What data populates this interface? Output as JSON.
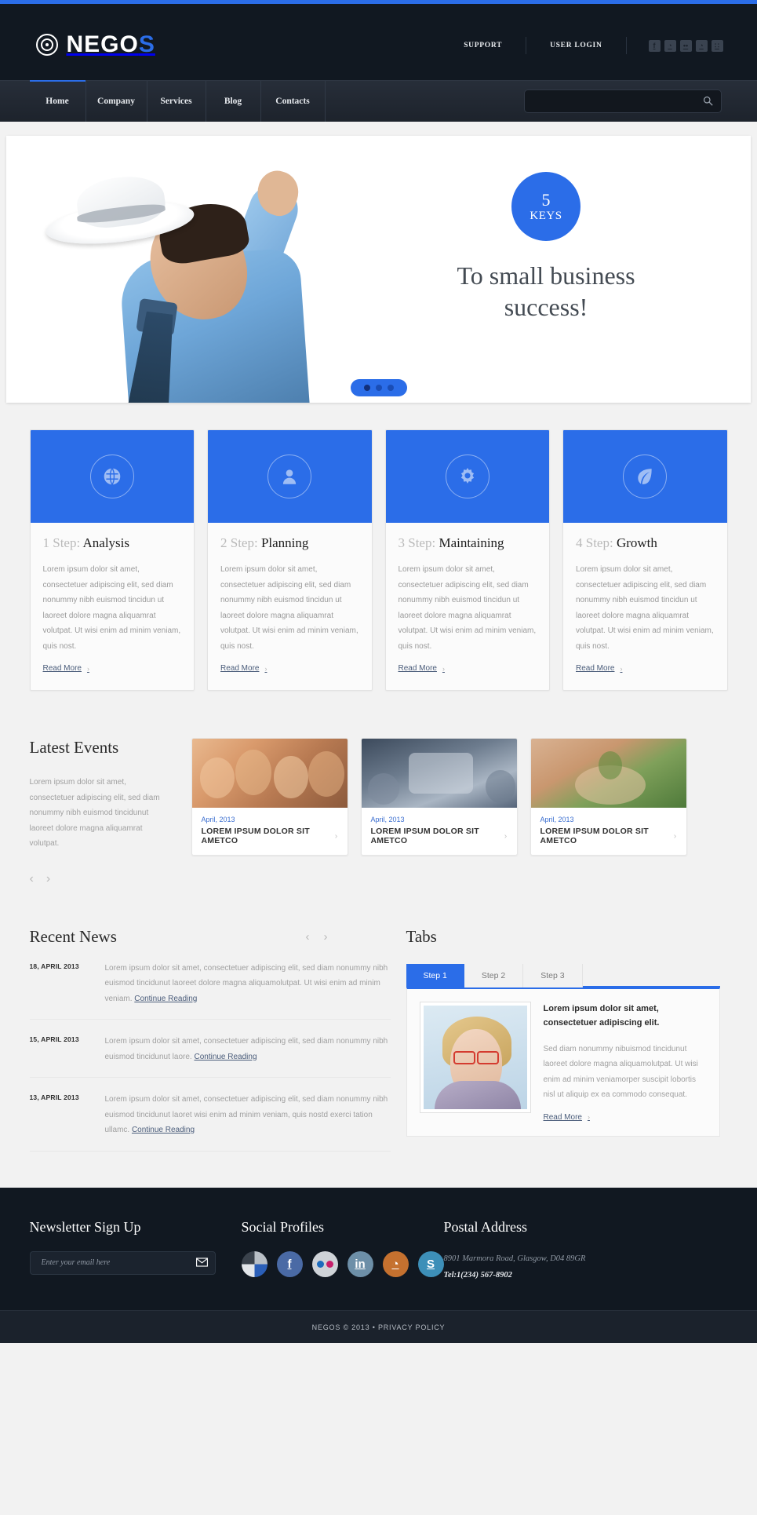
{
  "brand": {
    "name_main": "NEGO",
    "name_accent": "S"
  },
  "header": {
    "links": [
      {
        "label": "SUPPORT"
      },
      {
        "label": "USER LOGIN"
      }
    ],
    "socials": [
      {
        "name": "facebook-icon",
        "glyph": "f"
      },
      {
        "name": "rss-icon",
        "glyph": "◔"
      },
      {
        "name": "flickr-icon",
        "glyph": "••"
      },
      {
        "name": "rss-feed-icon",
        "glyph": "◔"
      },
      {
        "name": "dribbble-icon",
        "glyph": "∷"
      }
    ]
  },
  "nav": {
    "items": [
      {
        "label": "Home",
        "active": true
      },
      {
        "label": "Company",
        "active": false
      },
      {
        "label": "Services",
        "active": false
      },
      {
        "label": "Blog",
        "active": false
      },
      {
        "label": "Contacts",
        "active": false
      }
    ],
    "search_placeholder": ""
  },
  "slider": {
    "badge_number": "5",
    "badge_word": "KEYS",
    "title_line1": "To small business",
    "title_line2": "success!",
    "dots": 3,
    "active_dot": 1
  },
  "steps": [
    {
      "number": "1 Step:",
      "title": "Analysis",
      "icon": "globe-icon",
      "text": "Lorem ipsum dolor sit amet, consectetuer adipiscing elit, sed diam nonummy nibh euismod tincidun ut laoreet dolore magna aliquamrat volutpat. Ut wisi enim ad minim veniam, quis nost.",
      "link": "Read More"
    },
    {
      "number": "2 Step:",
      "title": "Planning",
      "icon": "user-icon",
      "text": "Lorem ipsum dolor sit amet, consectetuer adipiscing elit, sed diam nonummy nibh euismod tincidun ut laoreet dolore magna aliquamrat volutpat. Ut wisi enim ad minim veniam, quis nost.",
      "link": "Read More"
    },
    {
      "number": "3 Step:",
      "title": "Maintaining",
      "icon": "gear-icon",
      "text": "Lorem ipsum dolor sit amet, consectetuer adipiscing elit, sed diam nonummy nibh euismod tincidun ut laoreet dolore magna aliquamrat volutpat. Ut wisi enim ad minim veniam, quis nost.",
      "link": "Read More"
    },
    {
      "number": "4 Step:",
      "title": "Growth",
      "icon": "leaf-icon",
      "text": "Lorem ipsum dolor sit amet, consectetuer adipiscing elit, sed diam nonummy nibh euismod tincidun ut laoreet dolore magna aliquamrat volutpat. Ut wisi enim ad minim veniam, quis nost.",
      "link": "Read More"
    }
  ],
  "events": {
    "title": "Latest Events",
    "intro": "Lorem ipsum dolor sit amet, consectetuer adipiscing elit, sed diam nonummy nibh euismod tincidunut laoreet dolore magna aliquamrat volutpat.",
    "prev": "‹",
    "next": "›",
    "cards": [
      {
        "date": "April, 2013",
        "name": "LOREM IPSUM DOLOR SIT AMETCO"
      },
      {
        "date": "April, 2013",
        "name": "LOREM IPSUM DOLOR SIT AMETCO"
      },
      {
        "date": "April, 2013",
        "name": "LOREM IPSUM DOLOR SIT AMETCO"
      }
    ]
  },
  "news": {
    "title": "Recent News",
    "prev": "‹",
    "next": "›",
    "items": [
      {
        "date": "18, APRIL 2013",
        "text": "Lorem ipsum dolor sit amet, consectetuer adipiscing elit, sed diam nonummy nibh euismod tincidunut laoreet dolore magna aliquamolutpat. Ut wisi enim ad minim veniam. ",
        "link": "Continue Reading"
      },
      {
        "date": "15, APRIL 2013",
        "text": "Lorem ipsum dolor sit amet, consectetuer adipiscing elit, sed diam nonummy nibh euismod tincidunut laore. ",
        "link": "Continue Reading"
      },
      {
        "date": "13, APRIL 2013",
        "text": "Lorem ipsum dolor sit amet, consectetuer adipiscing elit, sed diam nonummy nibh euismod tincidunut laoret wisi enim ad minim veniam, quis nostd exerci tation ullamc. ",
        "link": "Continue Reading"
      }
    ]
  },
  "tabs": {
    "title": "Tabs",
    "items": [
      {
        "label": "Step 1",
        "active": true
      },
      {
        "label": "Step 2",
        "active": false
      },
      {
        "label": "Step 3",
        "active": false
      }
    ],
    "panel": {
      "heading": "Lorem ipsum dolor sit amet, consectetuer adipiscing elit.",
      "text": "Sed diam nonummy nibuismod tincidunut laoreet dolore magna aliquamolutpat. Ut wisi enim ad minim veniamorper suscipit lobortis nisl ut aliquip ex ea commodo consequat.",
      "link": "Read More",
      "image_alt": "woman-with-glasses-photo"
    }
  },
  "footer": {
    "newsletter": {
      "title": "Newsletter Sign Up",
      "placeholder": "Enter your email here",
      "value": "",
      "submit_icon": "envelope-icon"
    },
    "social": {
      "title": "Social Profiles",
      "items": [
        {
          "name": "google-plus-icon",
          "glyph": "",
          "cls": "fsoc-gp"
        },
        {
          "name": "facebook-icon",
          "glyph": "f",
          "cls": "fsoc-fb"
        },
        {
          "name": "flickr-icon",
          "glyph": "",
          "cls": "fsoc-fl"
        },
        {
          "name": "linkedin-icon",
          "glyph": "in",
          "cls": "fsoc-in"
        },
        {
          "name": "rss-icon",
          "glyph": "◔",
          "cls": "fsoc-rss"
        },
        {
          "name": "skype-icon",
          "glyph": "S",
          "cls": "fsoc-sk"
        }
      ]
    },
    "postal": {
      "title": "Postal Address",
      "address": "8901 Marmora Road, Glasgow, D04 89GR",
      "tel": "Tel:1(234) 567-8902"
    },
    "copyright": "NEGOS © 2013 • PRIVACY POLICY"
  },
  "colors": {
    "accent": "#2b6de8",
    "dark": "#111821",
    "page_bg": "#f2f2f2"
  }
}
